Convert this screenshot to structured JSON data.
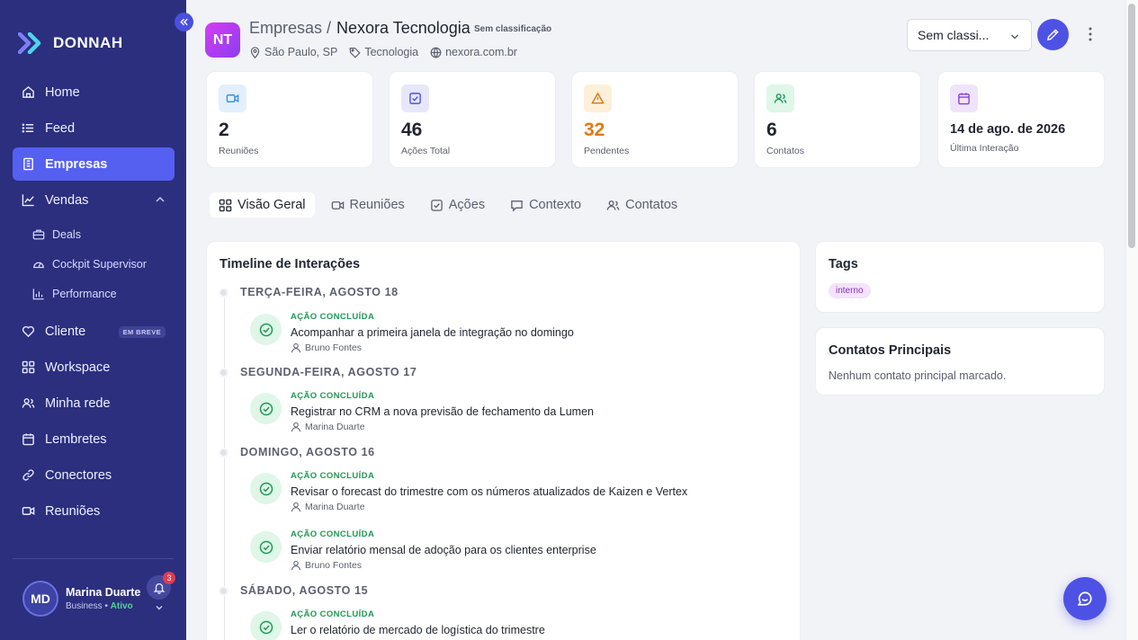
{
  "brand": {
    "name": "DONNAH"
  },
  "sidebar": {
    "items": [
      {
        "label": "Home",
        "icon": "home-icon"
      },
      {
        "label": "Feed",
        "icon": "list-icon"
      },
      {
        "label": "Empresas",
        "icon": "building-icon",
        "active": true
      },
      {
        "label": "Vendas",
        "icon": "chart-line-icon",
        "expanded": true
      }
    ],
    "sub_items": [
      {
        "label": "Deals",
        "icon": "briefcase-icon"
      },
      {
        "label": "Cockpit Supervisor",
        "icon": "gauge-icon"
      },
      {
        "label": "Performance",
        "icon": "bar-chart-icon"
      }
    ],
    "items2": [
      {
        "label": "Cliente",
        "icon": "heart-icon",
        "badge": "EM BREVE"
      },
      {
        "label": "Workspace",
        "icon": "grid-icon"
      },
      {
        "label": "Minha rede",
        "icon": "users-icon"
      },
      {
        "label": "Lembretes",
        "icon": "calendar-icon"
      },
      {
        "label": "Conectores",
        "icon": "link-icon"
      },
      {
        "label": "Reuniões",
        "icon": "video-icon"
      }
    ]
  },
  "user": {
    "initials": "MD",
    "name": "Marina Duarte",
    "plan": "Business",
    "separator": "•",
    "status": "Ativo",
    "notifications": "3"
  },
  "header": {
    "initials": "NT",
    "parent": "Empresas /",
    "company": "Nexora Tecnologia",
    "classification": "Sem classificação",
    "location": "São Paulo, SP",
    "sector": "Tecnologia",
    "website": "nexora.com.br",
    "select_value": "Sem classi..."
  },
  "stats": [
    {
      "value": "2",
      "label": "Reuniões",
      "icon": "video-icon",
      "color": "#3b8fe0",
      "bg": "#e3f0fc"
    },
    {
      "value": "46",
      "label": "Ações Total",
      "icon": "checkbox-icon",
      "color": "#4d52e5",
      "bg": "#e6e7fb"
    },
    {
      "value": "32",
      "label": "Pendentes",
      "icon": "warning-icon",
      "color": "#d9770e",
      "bg": "#fdf0d8",
      "value_color": "#e07a12"
    },
    {
      "value": "6",
      "label": "Contatos",
      "icon": "users-icon",
      "color": "#1e9a55",
      "bg": "#dff6e8"
    },
    {
      "value": "14 de ago. de 2026",
      "label": "Última Interação",
      "icon": "calendar-icon",
      "color": "#8a3fd6",
      "bg": "#efe4fb"
    }
  ],
  "tabs": [
    {
      "label": "Visão Geral",
      "icon": "grid-icon",
      "active": true
    },
    {
      "label": "Reuniões",
      "icon": "video-icon"
    },
    {
      "label": "Ações",
      "icon": "checkbox-icon"
    },
    {
      "label": "Contexto",
      "icon": "chat-icon"
    },
    {
      "label": "Contatos",
      "icon": "users-icon"
    }
  ],
  "timeline": {
    "title": "Timeline de Interações",
    "groups": [
      {
        "date": "TERÇA-FEIRA, AGOSTO 18",
        "events": [
          {
            "status": "AÇÃO CONCLUÍDA",
            "text": "Acompanhar a primeira janela de integração no domingo",
            "user": "Bruno Fontes"
          }
        ]
      },
      {
        "date": "SEGUNDA-FEIRA, AGOSTO 17",
        "events": [
          {
            "status": "AÇÃO CONCLUÍDA",
            "text": "Registrar no CRM a nova previsão de fechamento da Lumen",
            "user": "Marina Duarte"
          }
        ]
      },
      {
        "date": "DOMINGO, AGOSTO 16",
        "events": [
          {
            "status": "AÇÃO CONCLUÍDA",
            "text": "Revisar o forecast do trimestre com os números atualizados de Kaizen e Vertex",
            "user": "Marina Duarte"
          },
          {
            "status": "AÇÃO CONCLUÍDA",
            "text": "Enviar relatório mensal de adoção para os clientes enterprise",
            "user": "Bruno Fontes"
          }
        ]
      },
      {
        "date": "SÁBADO, AGOSTO 15",
        "events": [
          {
            "status": "AÇÃO CONCLUÍDA",
            "text": "Ler o relatório de mercado de logística do trimestre",
            "user": ""
          }
        ]
      }
    ]
  },
  "tags_card": {
    "title": "Tags",
    "tags": [
      "interno"
    ]
  },
  "contacts_card": {
    "title": "Contatos Principais",
    "empty": "Nenhum contato principal marcado."
  }
}
